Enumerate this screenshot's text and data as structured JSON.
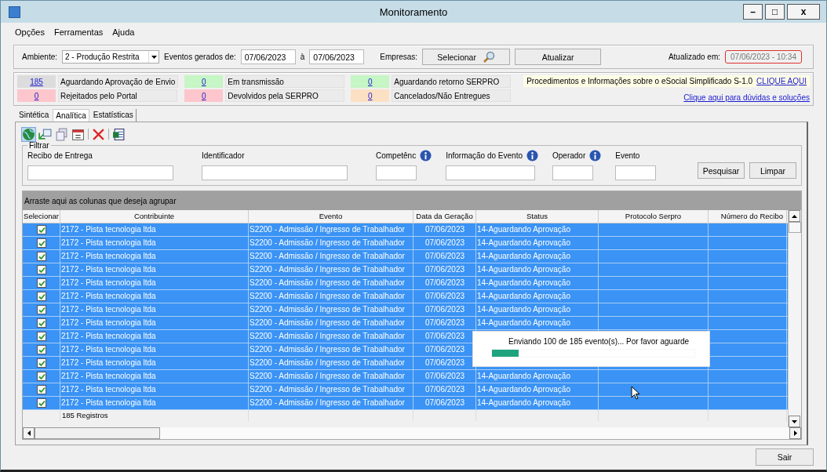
{
  "window": {
    "title": "Monitoramento",
    "controls": [
      "–",
      "□",
      "x"
    ]
  },
  "menu": [
    "Opções",
    "Ferramentas",
    "Ajuda"
  ],
  "toolbar": {
    "ambiente_label": "Ambiente:",
    "ambiente_value": "2 - Produção Restrita",
    "eventos_label": "Eventos gerados de:",
    "date_from": "07/06/2023",
    "date_sep": "à",
    "date_to": "07/06/2023",
    "empresas_label": "Empresas:",
    "select_button": "Selecionar",
    "refresh_button": "Atualizar",
    "updated_label": "Atualizado em:",
    "updated_value": "07/06/2023 - 10:34"
  },
  "counters": [
    {
      "count": "185",
      "label": "Aguardando Aprovação de Envio",
      "color": "#dcdcdc"
    },
    {
      "count": "0",
      "label": "Em transmissão",
      "color": "#c6f5c6"
    },
    {
      "count": "0",
      "label": "Aguardando retorno SERPRO",
      "color": "#c6f5c6"
    },
    {
      "count": "0",
      "label": "Rejeitados pelo Portal",
      "color": "#fcc6cc"
    },
    {
      "count": "0",
      "label": "Devolvidos pela SERPRO",
      "color": "#fcc6cc"
    },
    {
      "count": "0",
      "label": "Cancelados/Não Entregues",
      "color": "#fce0c4"
    }
  ],
  "info": {
    "text": "Procedimentos e Informações sobre o eSocial Simplificado S-1.0",
    "link": "CLIQUE AQUI",
    "help_link": "Clique aqui para dúvidas e soluções"
  },
  "tabs": [
    {
      "label": "Sintética",
      "selected": false
    },
    {
      "label": "Analítica",
      "selected": true
    },
    {
      "label": "Estatísticas",
      "selected": false
    }
  ],
  "filter": {
    "title": "Filtrar",
    "fields": [
      {
        "label": "Recibo de Entrega",
        "info": false
      },
      {
        "label": "Identificador",
        "info": false
      },
      {
        "label": "Competênc",
        "info": true
      },
      {
        "label": "Informação do Evento",
        "info": true
      },
      {
        "label": "Operador",
        "info": true
      },
      {
        "label": "Evento",
        "info": false
      }
    ],
    "buttons": [
      "Pesquisar",
      "Limpar"
    ]
  },
  "grid": {
    "group_hint": "Arraste aqui as colunas que deseja agrupar",
    "columns": [
      "Selecionar",
      "Contribuinte",
      "Evento",
      "Data da Geração",
      "Status",
      "Protocolo Serpro",
      "Número do Recibo"
    ],
    "rows": [
      {
        "selected": true,
        "checked": true,
        "contribuinte": "2172 - Pista tecnologia ltda",
        "evento": "S2200 - Admissão / Ingresso de Trabalhador",
        "data": "07/06/2023",
        "status": "14-Aguardando Aprovação"
      },
      {
        "selected": true,
        "checked": true,
        "contribuinte": "2172 - Pista tecnologia ltda",
        "evento": "S2200 - Admissão / Ingresso de Trabalhador",
        "data": "07/06/2023",
        "status": "14-Aguardando Aprovação"
      },
      {
        "selected": true,
        "checked": true,
        "contribuinte": "2172 - Pista tecnologia ltda",
        "evento": "S2200 - Admissão / Ingresso de Trabalhador",
        "data": "07/06/2023",
        "status": "14-Aguardando Aprovação"
      },
      {
        "selected": true,
        "checked": true,
        "contribuinte": "2172 - Pista tecnologia ltda",
        "evento": "S2200 - Admissão / Ingresso de Trabalhador",
        "data": "07/06/2023",
        "status": "14-Aguardando Aprovação"
      },
      {
        "selected": true,
        "checked": true,
        "contribuinte": "2172 - Pista tecnologia ltda",
        "evento": "S2200 - Admissão / Ingresso de Trabalhador",
        "data": "07/06/2023",
        "status": "14-Aguardando Aprovação"
      },
      {
        "selected": true,
        "checked": true,
        "contribuinte": "2172 - Pista tecnologia ltda",
        "evento": "S2200 - Admissão / Ingresso de Trabalhador",
        "data": "07/06/2023",
        "status": "14-Aguardando Aprovação"
      },
      {
        "selected": true,
        "checked": true,
        "contribuinte": "2172 - Pista tecnologia ltda",
        "evento": "S2200 - Admissão / Ingresso de Trabalhador",
        "data": "07/06/2023",
        "status": "14-Aguardando Aprovação"
      },
      {
        "selected": true,
        "checked": true,
        "contribuinte": "2172 - Pista tecnologia ltda",
        "evento": "S2200 - Admissão / Ingresso de Trabalhador",
        "data": "07/06/2023",
        "status": "14-Aguardando Aprovação"
      },
      {
        "selected": true,
        "checked": true,
        "contribuinte": "2172 - Pista tecnologia ltda",
        "evento": "S2200 - Admissão / Ingresso de Trabalhador",
        "data": "07/06/2023"
      },
      {
        "selected": true,
        "checked": true,
        "contribuinte": "2172 - Pista tecnologia ltda",
        "evento": "S2200 - Admissão / Ingresso de Trabalhador",
        "data": "07/06/2023"
      },
      {
        "selected": true,
        "checked": true,
        "contribuinte": "2172 - Pista tecnologia ltda",
        "evento": "S2200 - Admissão / Ingresso de Trabalhador",
        "data": "07/06/2023"
      },
      {
        "selected": true,
        "checked": true,
        "contribuinte": "2172 - Pista tecnologia ltda",
        "evento": "S2200 - Admissão / Ingresso de Trabalhador",
        "data": "07/06/2023",
        "status": "14-Aguardando Aprovação"
      },
      {
        "selected": true,
        "checked": true,
        "contribuinte": "2172 - Pista tecnologia ltda",
        "evento": "S2200 - Admissão / Ingresso de Trabalhador",
        "data": "07/06/2023",
        "status": "14-Aguardando Aprovação"
      },
      {
        "selected": true,
        "checked": true,
        "contribuinte": "2172 - Pista tecnologia ltda",
        "evento": "S2200 - Admissão / Ingresso de Trabalhador",
        "data": "07/06/2023",
        "status": "14-Aguardando Aprovação"
      }
    ],
    "footer": "185 Registros"
  },
  "progress": {
    "message": "Enviando 100 de 185 evento(s)... Por favor aguarde",
    "level": 0.13
  },
  "exit_button": "Sair"
}
